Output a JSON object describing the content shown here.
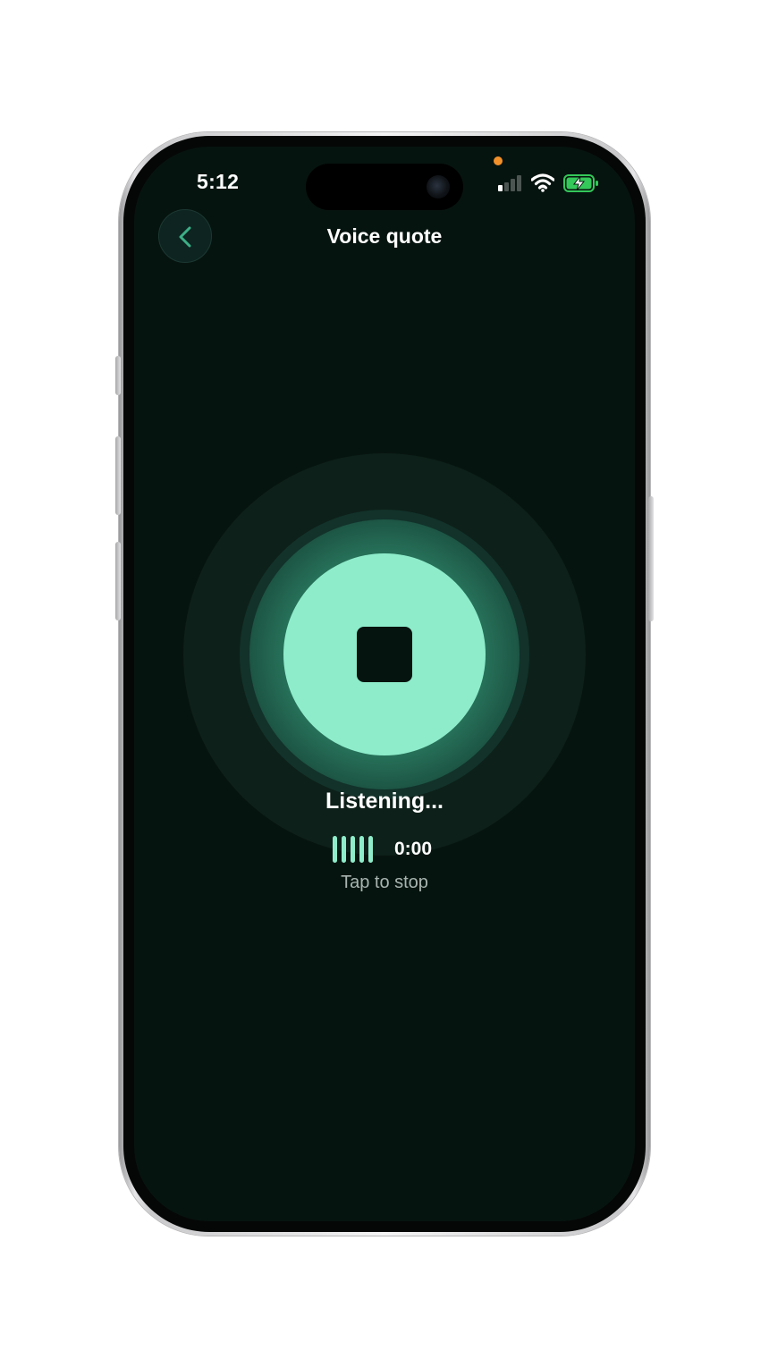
{
  "status_bar": {
    "time": "5:12",
    "icons": [
      "signal-icon",
      "wifi-icon",
      "battery-charging-icon"
    ],
    "privacy_indicator_color": "#f2902a"
  },
  "header": {
    "back_icon": "chevron-left-icon",
    "title": "Voice quote"
  },
  "recorder": {
    "button_icon": "stop-icon",
    "status": "Listening...",
    "waveform_icon": "waveform-icon",
    "timer": "0:00",
    "hint": "Tap to stop"
  },
  "colors": {
    "background": "#06140f",
    "accent": "#8eeccb",
    "text_primary": "#ffffff",
    "text_secondary": "#a8b5b0",
    "battery": "#34c759"
  }
}
